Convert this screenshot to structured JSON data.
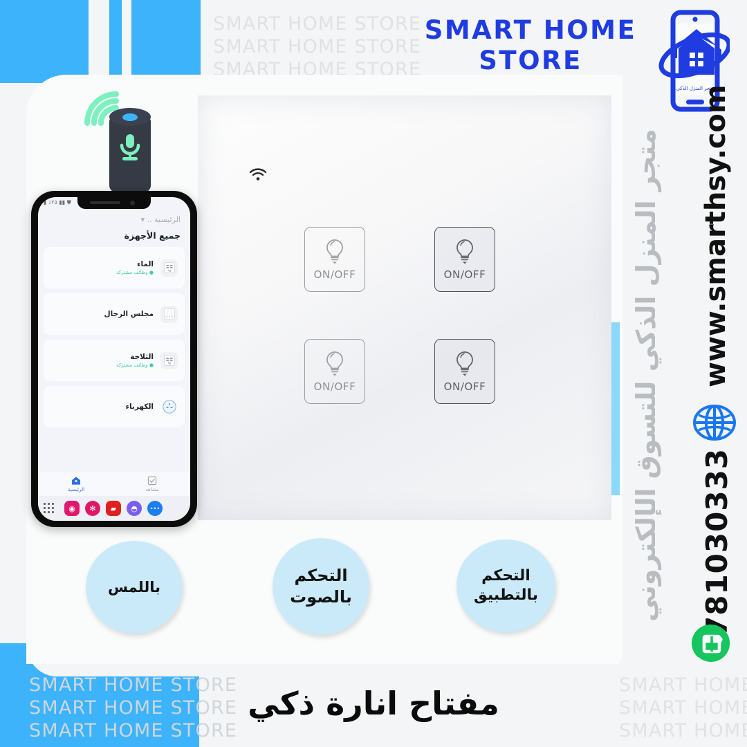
{
  "brand": {
    "logo_line1": "SMART HOME",
    "logo_line2": "STORE",
    "logo_badge_ar": "متجر المنزل الذكي",
    "accent_blue": "#3cb3fb",
    "logo_blue": "#1f3ce0",
    "circle_blue": "#caeaf9",
    "mint": "#7df0c0",
    "whatsapp_green": "#16c55e"
  },
  "watermark": {
    "text": "SMART HOME STORE",
    "top_block": "SMART HOME STORE\nSMART HOME STORE\nSMART HOME STORE",
    "bottom_left_block": "SMART HOME STORE\nSMART HOME STORE\nSMART HOME STORE",
    "bottom_right_block": "SMART HOME\nSMART HOME\nSMART HOME"
  },
  "phone": {
    "statusbar": "▮ ٪٢٥ ▮▮ ⛊",
    "home_selector": "الرئيسية ..",
    "section_title": "جميع الأجهزة",
    "devices": [
      {
        "name": "الماء",
        "subtitle": "وظائف مشتركة",
        "icon": "socket-icon"
      },
      {
        "name": "مجلس الرجال",
        "subtitle": "",
        "icon": "switch-panel-icon"
      },
      {
        "name": "الثلاجة",
        "subtitle": "وظائف مشتركة",
        "icon": "socket-icon"
      },
      {
        "name": "الكهرباء",
        "subtitle": "",
        "icon": "plug-circle-icon"
      }
    ],
    "nav": [
      {
        "label": "الرئيسية",
        "icon": "home-icon",
        "active": true
      },
      {
        "label": "مشاهد",
        "icon": "scenes-icon",
        "active": false
      }
    ],
    "dock": [
      {
        "name": "apps-grid-icon",
        "color": "#eef0f5",
        "glyph": ""
      },
      {
        "name": "camera-icon",
        "color": "#e0196f",
        "glyph": "◉"
      },
      {
        "name": "snowflake-icon",
        "color": "#e01764",
        "glyph": "✻"
      },
      {
        "name": "flipboard-icon",
        "color": "#e02020",
        "glyph": "▰"
      },
      {
        "name": "browser-icon",
        "color": "#7b5ef0",
        "glyph": "◓"
      },
      {
        "name": "messages-icon",
        "color": "#1c7ef0",
        "glyph": "•••"
      }
    ]
  },
  "switch_panel": {
    "wifi_icon": "wifi-icon",
    "buttons": [
      {
        "label": "ON/OFF",
        "icon": "bulb-icon",
        "state": "off"
      },
      {
        "label": "ON/OFF",
        "icon": "bulb-icon",
        "state": "pressed"
      },
      {
        "label": "ON/OFF",
        "icon": "bulb-icon",
        "state": "off"
      },
      {
        "label": "ON/OFF",
        "icon": "bulb-icon",
        "state": "pressed"
      }
    ]
  },
  "speaker": {
    "icon": "smart-speaker-icon",
    "mic_icon": "microphone-icon",
    "signal_icon": "signal-waves-icon"
  },
  "features": [
    {
      "label": "باللمس",
      "name": "feature-touch"
    },
    {
      "label": "التحكم\nبالصوت",
      "name": "feature-voice"
    },
    {
      "label": "التحكم\nبالتطبيق",
      "name": "feature-app"
    }
  ],
  "contact": {
    "tagline_ar": "متجر المنزل الذكي للتسوق الإلكتروني",
    "website": "www.smarthsy.com",
    "phone": "781030333",
    "globe_icon": "globe-icon",
    "whatsapp_icon": "whatsapp-icon"
  },
  "product": {
    "title_ar": "مفتاح انارة ذكي"
  }
}
